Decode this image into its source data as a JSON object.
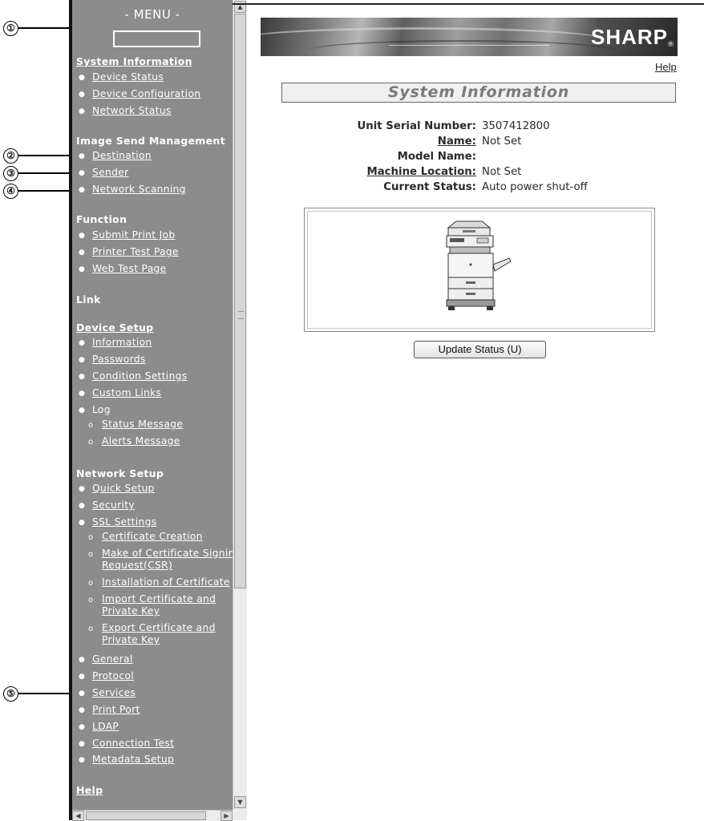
{
  "callouts": [
    "①",
    "②",
    "③",
    "④",
    "⑤"
  ],
  "sidebar": {
    "menu_title": "- MENU -",
    "system_information": "System Information",
    "device_status": "Device Status",
    "device_configuration": "Device Configuration",
    "network_status": "Network Status",
    "image_send_management": "Image Send Management",
    "destination": "Destination",
    "sender": "Sender",
    "network_scanning": "Network Scanning",
    "function": "Function",
    "submit_print_job": "Submit Print Job",
    "printer_test_page": "Printer Test Page",
    "web_test_page": "Web Test Page",
    "link": "Link",
    "device_setup": "Device Setup",
    "information": "Information",
    "passwords": "Passwords",
    "condition_settings": "Condition Settings",
    "custom_links": "Custom Links",
    "log": "Log",
    "status_message": "Status Message",
    "alerts_message": "Alerts Message",
    "network_setup": "Network Setup",
    "quick_setup": "Quick Setup",
    "security": "Security",
    "ssl_settings": "SSL Settings",
    "certificate_creation": "Certificate Creation",
    "make_csr_line1": "Make of Certificate Signin",
    "make_csr_line2": "Request(CSR)",
    "installation_of_certificate": "Installation of Certificate",
    "import_cert_line1": "Import Certificate and",
    "import_cert_line2": "Private Key",
    "export_cert_line1": "Export Certificate and",
    "export_cert_line2": "Private Key",
    "general": "General",
    "protocol": "Protocol",
    "services": "Services",
    "print_port": "Print Port",
    "ldap": "LDAP",
    "connection_test": "Connection Test",
    "metadata_setup": "Metadata Setup",
    "help": "Help",
    "bullet_glyph": "●",
    "sub_bullet_glyph": "o"
  },
  "header": {
    "logo": "SHARP",
    "logo_mark": "®",
    "help": "Help"
  },
  "main": {
    "title": "System Information",
    "fields": {
      "unit_serial_label": "Unit Serial Number:",
      "unit_serial_value": "3507412800",
      "name_label": "Name:",
      "name_value": "Not Set",
      "model_label": "Model Name:",
      "model_value": "",
      "location_label": "Machine Location:",
      "location_value": "Not Set",
      "status_label": "Current Status:",
      "status_value": "Auto power shut-off"
    },
    "update_button": "Update Status (U)"
  },
  "icons": {
    "device": "printer-copier-icon",
    "scroll_up": "▲",
    "scroll_down": "▼",
    "scroll_left": "◀",
    "scroll_right": "▶"
  },
  "colors": {
    "sidebar_bg": "#8c8c8c",
    "sidebar_text": "#ffffff",
    "title_text": "#7a7a7a"
  }
}
